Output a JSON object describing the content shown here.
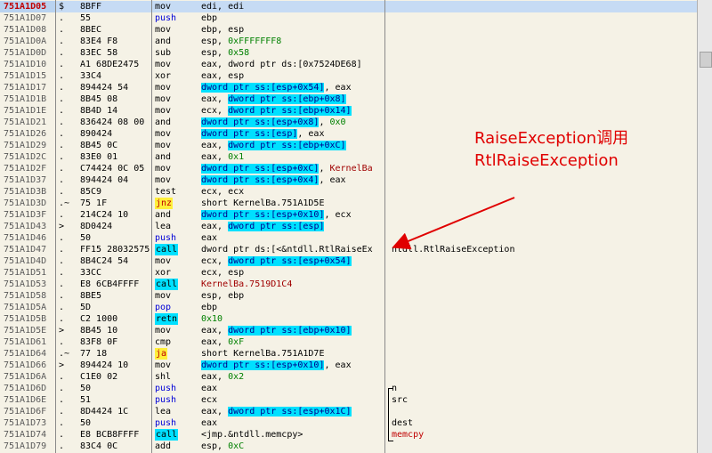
{
  "rows": [
    {
      "addr": "751A1D05",
      "mk": "$",
      "hex": "8BFF",
      "mn": "mov",
      "mnStyle": "",
      "op": [
        {
          "t": "edi, edi"
        }
      ],
      "cm": "",
      "sel": true
    },
    {
      "addr": "751A1D07",
      "mk": ".",
      "hex": "55",
      "mn": "push",
      "mnStyle": "blue",
      "op": [
        {
          "t": "ebp"
        }
      ],
      "cm": ""
    },
    {
      "addr": "751A1D08",
      "mk": ".",
      "hex": "8BEC",
      "mn": "mov",
      "mnStyle": "",
      "op": [
        {
          "t": "ebp, esp"
        }
      ],
      "cm": ""
    },
    {
      "addr": "751A1D0A",
      "mk": ".",
      "hex": "83E4 F8",
      "mn": "and",
      "mnStyle": "",
      "op": [
        {
          "t": "esp, "
        },
        {
          "t": "0xFFFFFFF8",
          "c": "num"
        }
      ],
      "cm": ""
    },
    {
      "addr": "751A1D0D",
      "mk": ".",
      "hex": "83EC 58",
      "mn": "sub",
      "mnStyle": "",
      "op": [
        {
          "t": "esp, "
        },
        {
          "t": "0x58",
          "c": "num"
        }
      ],
      "cm": ""
    },
    {
      "addr": "751A1D10",
      "mk": ".",
      "hex": "A1 68DE2475",
      "mn": "mov",
      "mnStyle": "",
      "op": [
        {
          "t": "eax, dword ptr ds:[0x7524DE68]"
        }
      ],
      "cm": ""
    },
    {
      "addr": "751A1D15",
      "mk": ".",
      "hex": "33C4",
      "mn": "xor",
      "mnStyle": "",
      "op": [
        {
          "t": "eax, esp"
        }
      ],
      "cm": ""
    },
    {
      "addr": "751A1D17",
      "mk": ".",
      "hex": "894424 54",
      "mn": "mov",
      "mnStyle": "",
      "op": [
        {
          "t": "dword ptr ss:[esp+0x54]",
          "c": "mem"
        },
        {
          "t": ", eax"
        }
      ],
      "cm": ""
    },
    {
      "addr": "751A1D1B",
      "mk": ".",
      "hex": "8B45 08",
      "mn": "mov",
      "mnStyle": "",
      "op": [
        {
          "t": "eax, "
        },
        {
          "t": "dword ptr ss:[ebp+0x8]",
          "c": "mem"
        }
      ],
      "cm": ""
    },
    {
      "addr": "751A1D1E",
      "mk": ".",
      "hex": "8B4D 14",
      "mn": "mov",
      "mnStyle": "",
      "op": [
        {
          "t": "ecx, "
        },
        {
          "t": "dword ptr ss:[ebp+0x14]",
          "c": "mem"
        }
      ],
      "cm": ""
    },
    {
      "addr": "751A1D21",
      "mk": ".",
      "hex": "836424 08 00",
      "mn": "and",
      "mnStyle": "",
      "op": [
        {
          "t": "dword ptr ss:[esp+0x8]",
          "c": "mem"
        },
        {
          "t": ", "
        },
        {
          "t": "0x0",
          "c": "num"
        }
      ],
      "cm": ""
    },
    {
      "addr": "751A1D26",
      "mk": ".",
      "hex": "890424",
      "mn": "mov",
      "mnStyle": "",
      "op": [
        {
          "t": "dword ptr ss:[esp]",
          "c": "mem"
        },
        {
          "t": ", eax"
        }
      ],
      "cm": ""
    },
    {
      "addr": "751A1D29",
      "mk": ".",
      "hex": "8B45 0C",
      "mn": "mov",
      "mnStyle": "",
      "op": [
        {
          "t": "eax, "
        },
        {
          "t": "dword ptr ss:[ebp+0xC]",
          "c": "mem"
        }
      ],
      "cm": ""
    },
    {
      "addr": "751A1D2C",
      "mk": ".",
      "hex": "83E0 01",
      "mn": "and",
      "mnStyle": "",
      "op": [
        {
          "t": "eax, "
        },
        {
          "t": "0x1",
          "c": "num"
        }
      ],
      "cm": ""
    },
    {
      "addr": "751A1D2F",
      "mk": ".",
      "hex": "C74424 0C 05",
      "mn": "mov",
      "mnStyle": "",
      "op": [
        {
          "t": "dword ptr ss:[esp+0xC]",
          "c": "mem"
        },
        {
          "t": ", "
        },
        {
          "t": "KernelBa",
          "c": "red"
        }
      ],
      "cm": ""
    },
    {
      "addr": "751A1D37",
      "mk": ".",
      "hex": "894424 04",
      "mn": "mov",
      "mnStyle": "",
      "op": [
        {
          "t": "dword ptr ss:[esp+0x4]",
          "c": "mem"
        },
        {
          "t": ", eax"
        }
      ],
      "cm": ""
    },
    {
      "addr": "751A1D3B",
      "mk": ".",
      "hex": "85C9",
      "mn": "test",
      "mnStyle": "",
      "op": [
        {
          "t": "ecx, ecx"
        }
      ],
      "cm": ""
    },
    {
      "addr": "751A1D3D",
      "mk": ".~",
      "hex": "75 1F",
      "mn": "jnz",
      "mnStyle": "hy",
      "op": [
        {
          "t": "short KernelBa.751A1D5E"
        }
      ],
      "cm": ""
    },
    {
      "addr": "751A1D3F",
      "mk": ".",
      "hex": "214C24 10",
      "mn": "and",
      "mnStyle": "",
      "op": [
        {
          "t": "dword ptr ss:[esp+0x10]",
          "c": "mem"
        },
        {
          "t": ", ecx"
        }
      ],
      "cm": ""
    },
    {
      "addr": "751A1D43",
      "mk": ">",
      "hex": "8D0424",
      "mn": "lea",
      "mnStyle": "",
      "op": [
        {
          "t": "eax, "
        },
        {
          "t": "dword ptr ss:[esp]",
          "c": "mem"
        }
      ],
      "cm": ""
    },
    {
      "addr": "751A1D46",
      "mk": ".",
      "hex": "50",
      "mn": "push",
      "mnStyle": "blue",
      "op": [
        {
          "t": "eax"
        }
      ],
      "cm": ""
    },
    {
      "addr": "751A1D47",
      "mk": ".",
      "hex": "FF15 28032575",
      "mn": "call",
      "mnStyle": "hl",
      "op": [
        {
          "t": "dword ptr ds:[<&ntdll.RtlRaiseEx"
        }
      ],
      "cm": "ntdll.RtlRaiseException",
      "cmStyle": ""
    },
    {
      "addr": "751A1D4D",
      "mk": ".",
      "hex": "8B4C24 54",
      "mn": "mov",
      "mnStyle": "",
      "op": [
        {
          "t": "ecx, "
        },
        {
          "t": "dword ptr ss:[esp+0x54]",
          "c": "mem"
        }
      ],
      "cm": ""
    },
    {
      "addr": "751A1D51",
      "mk": ".",
      "hex": "33CC",
      "mn": "xor",
      "mnStyle": "",
      "op": [
        {
          "t": "ecx, esp"
        }
      ],
      "cm": ""
    },
    {
      "addr": "751A1D53",
      "mk": ".",
      "hex": "E8 6CB4FFFF",
      "mn": "call",
      "mnStyle": "hl",
      "op": [
        {
          "t": "KernelBa.7519D1C4",
          "c": "red"
        }
      ],
      "cm": ""
    },
    {
      "addr": "751A1D58",
      "mk": ".",
      "hex": "8BE5",
      "mn": "mov",
      "mnStyle": "",
      "op": [
        {
          "t": "esp, ebp"
        }
      ],
      "cm": ""
    },
    {
      "addr": "751A1D5A",
      "mk": ".",
      "hex": "5D",
      "mn": "pop",
      "mnStyle": "blue",
      "op": [
        {
          "t": "ebp"
        }
      ],
      "cm": ""
    },
    {
      "addr": "751A1D5B",
      "mk": ".",
      "hex": "C2 1000",
      "mn": "retn",
      "mnStyle": "hl",
      "op": [
        {
          "t": "0x10",
          "c": "num"
        }
      ],
      "cm": ""
    },
    {
      "addr": "751A1D5E",
      "mk": ">",
      "hex": "8B45 10",
      "mn": "mov",
      "mnStyle": "",
      "op": [
        {
          "t": "eax, "
        },
        {
          "t": "dword ptr ss:[ebp+0x10]",
          "c": "mem"
        }
      ],
      "cm": ""
    },
    {
      "addr": "751A1D61",
      "mk": ".",
      "hex": "83F8 0F",
      "mn": "cmp",
      "mnStyle": "",
      "op": [
        {
          "t": "eax, "
        },
        {
          "t": "0xF",
          "c": "num"
        }
      ],
      "cm": ""
    },
    {
      "addr": "751A1D64",
      "mk": ".~",
      "hex": "77 18",
      "mn": "ja",
      "mnStyle": "hy",
      "op": [
        {
          "t": "short KernelBa.751A1D7E"
        }
      ],
      "cm": ""
    },
    {
      "addr": "751A1D66",
      "mk": ">",
      "hex": "894424 10",
      "mn": "mov",
      "mnStyle": "",
      "op": [
        {
          "t": "dword ptr ss:[esp+0x10]",
          "c": "mem"
        },
        {
          "t": ", eax"
        }
      ],
      "cm": ""
    },
    {
      "addr": "751A1D6A",
      "mk": ".",
      "hex": "C1E0 02",
      "mn": "shl",
      "mnStyle": "",
      "op": [
        {
          "t": "eax, "
        },
        {
          "t": "0x2",
          "c": "num"
        }
      ],
      "cm": ""
    },
    {
      "addr": "751A1D6D",
      "mk": ".",
      "hex": "50",
      "mn": "push",
      "mnStyle": "blue",
      "op": [
        {
          "t": "eax"
        }
      ],
      "cm": "n",
      "cmStyle": ""
    },
    {
      "addr": "751A1D6E",
      "mk": ".",
      "hex": "51",
      "mn": "push",
      "mnStyle": "blue",
      "op": [
        {
          "t": "ecx"
        }
      ],
      "cm": "src",
      "cmStyle": ""
    },
    {
      "addr": "751A1D6F",
      "mk": ".",
      "hex": "8D4424 1C",
      "mn": "lea",
      "mnStyle": "",
      "op": [
        {
          "t": "eax, "
        },
        {
          "t": "dword ptr ss:[esp+0x1C]",
          "c": "mem"
        }
      ],
      "cm": "",
      "cmStyle": ""
    },
    {
      "addr": "751A1D73",
      "mk": ".",
      "hex": "50",
      "mn": "push",
      "mnStyle": "blue",
      "op": [
        {
          "t": "eax"
        }
      ],
      "cm": "dest",
      "cmStyle": ""
    },
    {
      "addr": "751A1D74",
      "mk": ".",
      "hex": "E8 BCB8FFFF",
      "mn": "call",
      "mnStyle": "hl",
      "op": [
        {
          "t": "<jmp.&ntdll.memcpy>"
        }
      ],
      "cm": "memcpy",
      "cmStyle": "red"
    },
    {
      "addr": "751A1D79",
      "mk": ".",
      "hex": "83C4 0C",
      "mn": "add",
      "mnStyle": "",
      "op": [
        {
          "t": "esp, "
        },
        {
          "t": "0xC",
          "c": "num"
        }
      ],
      "cm": ""
    }
  ],
  "annotation": {
    "line1": "RaiseException调用",
    "line2": "RtlRaiseException"
  },
  "colors": {
    "annotation": "#e00000",
    "highlight": "#00e0ff",
    "jump": "#ffef3b"
  }
}
